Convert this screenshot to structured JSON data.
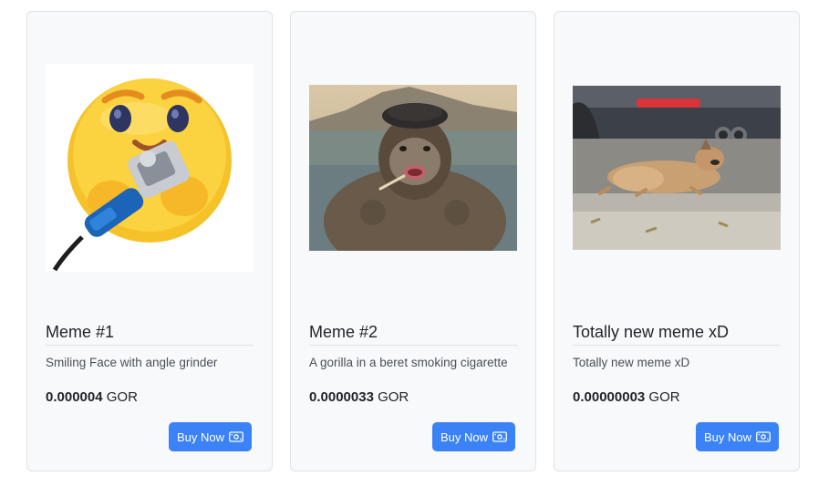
{
  "cards": [
    {
      "title": "Meme #1",
      "description": "Smiling Face with angle grinder",
      "price_value": "0.000004",
      "currency": "GOR",
      "button_label": "Buy Now",
      "button_icon": "cash-icon"
    },
    {
      "title": "Meme #2",
      "description": "A gorilla in a beret smoking cigarette",
      "price_value": "0.0000033",
      "currency": "GOR",
      "button_label": "Buy Now",
      "button_icon": "cash-icon"
    },
    {
      "title": "Totally new meme xD",
      "description": "Totally new meme xD",
      "price_value": "0.00000003",
      "currency": "GOR",
      "button_label": "Buy Now",
      "button_icon": "cash-icon"
    }
  ],
  "colors": {
    "accent": "#3b82f6",
    "card_bg": "#f8f9fb",
    "card_border": "#dfe2e6"
  }
}
